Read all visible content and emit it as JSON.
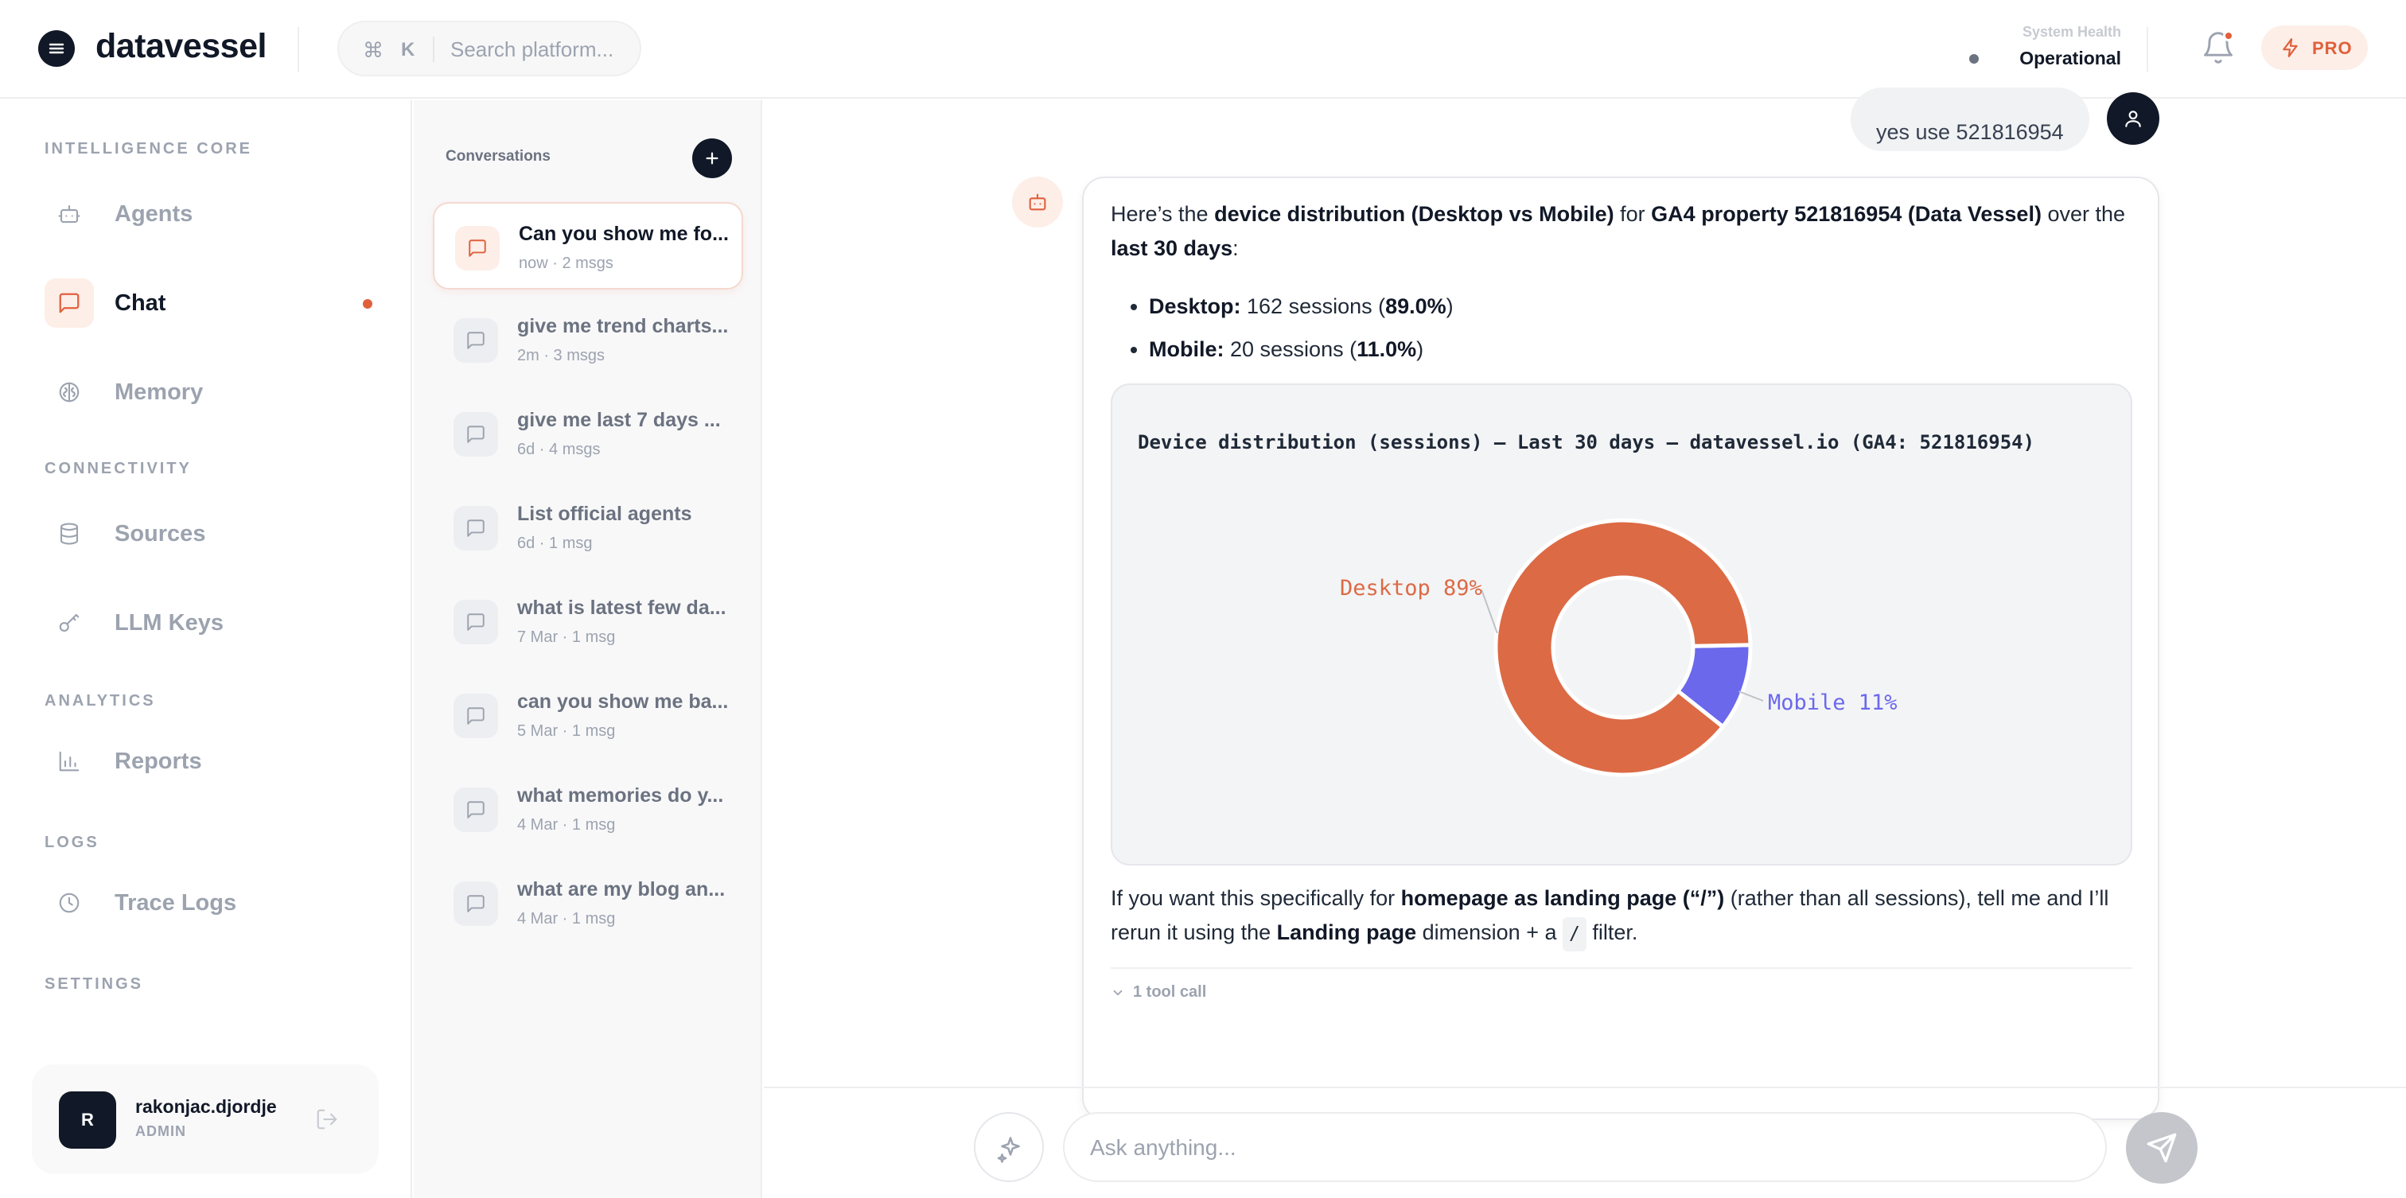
{
  "app": {
    "name": "datavessel"
  },
  "search": {
    "shortcut_symbol": "⌘",
    "shortcut_key": "K",
    "placeholder": "Search platform..."
  },
  "system_health": {
    "label": "System Health",
    "status": "Operational"
  },
  "badge": {
    "label": "PRO"
  },
  "sidebar": {
    "sections": [
      {
        "label": "INTELLIGENCE CORE"
      },
      {
        "label": "CONNECTIVITY"
      },
      {
        "label": "ANALYTICS"
      },
      {
        "label": "LOGS"
      },
      {
        "label": "SETTINGS"
      }
    ],
    "items": [
      {
        "label": "Agents",
        "icon": "bot-icon"
      },
      {
        "label": "Chat",
        "icon": "chat-icon",
        "active": true
      },
      {
        "label": "Memory",
        "icon": "brain-icon"
      },
      {
        "label": "Sources",
        "icon": "database-icon"
      },
      {
        "label": "LLM Keys",
        "icon": "key-icon"
      },
      {
        "label": "Reports",
        "icon": "bar-chart-icon"
      },
      {
        "label": "Trace Logs",
        "icon": "clock-icon"
      }
    ],
    "user": {
      "initial": "R",
      "name": "rakonjac.djordje",
      "role": "ADMIN"
    }
  },
  "conversations": {
    "title": "Conversations",
    "items": [
      {
        "name": "Can you show me fo...",
        "meta": "now · 2 msgs"
      },
      {
        "name": "give me trend charts...",
        "meta": "2m · 3 msgs"
      },
      {
        "name": "give me last 7 days ...",
        "meta": "6d · 4 msgs"
      },
      {
        "name": "List official agents",
        "meta": "6d · 1 msg"
      },
      {
        "name": "what is latest few da...",
        "meta": "7 Mar · 1 msg"
      },
      {
        "name": "can you show me ba...",
        "meta": "5 Mar · 1 msg"
      },
      {
        "name": "what memories do y...",
        "meta": "4 Mar · 1 msg"
      },
      {
        "name": "what are my blog an...",
        "meta": "4 Mar · 1 msg"
      }
    ]
  },
  "chat": {
    "user_message": "yes use 521816954",
    "intro": {
      "p1": "Here’s the ",
      "b1": "device distribution (Desktop vs Mobile)",
      "p2": " for ",
      "b2": "GA4 property 521816954 (Data Vessel)",
      "p3": " over the ",
      "b3": "last 30 days",
      "p4": ":"
    },
    "bullets": [
      {
        "label": "Desktop:",
        "text": " 162 sessions (",
        "pct": "89.0%",
        "close": ")"
      },
      {
        "label": "Mobile:",
        "text": " 20 sessions (",
        "pct": "11.0%",
        "close": ")"
      }
    ],
    "outro": {
      "p1": "If you want this specifically for ",
      "b1": "homepage as landing page (“/”)",
      "p2": " (rather than all sessions), tell me and I’ll rerun it using the ",
      "b2": "Landing page",
      "p3": " dimension + a ",
      "code": "/",
      "p4": " filter."
    },
    "tool_call": "1 tool call"
  },
  "chart_data": {
    "type": "pie",
    "title": "Device distribution (sessions) — Last 30 days — datavessel.io (GA4: 521816954)",
    "categories": [
      "Desktop",
      "Mobile"
    ],
    "values": [
      89,
      11
    ],
    "labels": [
      "Desktop 89%",
      "Mobile 11%"
    ],
    "colors": [
      "#dc6a45",
      "#6b68ec"
    ],
    "donut": true
  },
  "composer": {
    "placeholder": "Ask anything..."
  }
}
